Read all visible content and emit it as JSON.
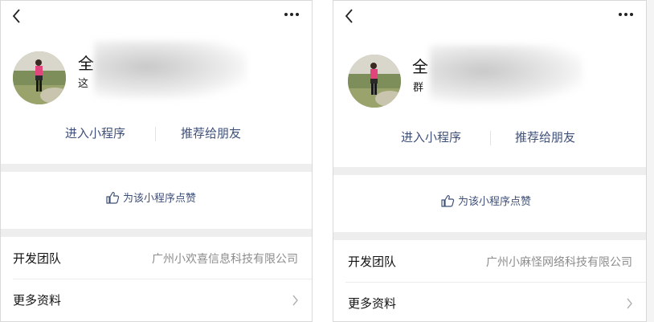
{
  "panels": [
    {
      "name_char": "全",
      "desc_char": "这",
      "actions": {
        "enter": "进入小程序",
        "recommend": "推荐给朋友"
      },
      "like_label": "为该小程序点赞",
      "team_label": "开发团队",
      "team_value": "广州小欢喜信息科技有限公司",
      "more_label": "更多资料"
    },
    {
      "name_char": "全",
      "desc_char": "群",
      "actions": {
        "enter": "进入小程序",
        "recommend": "推荐给朋友"
      },
      "like_label": "为该小程序点赞",
      "team_label": "开发团队",
      "team_value": "广州小麻怪网络科技有限公司",
      "more_label": "更多资料"
    }
  ],
  "colors": {
    "link": "#3f5078",
    "value_gray": "#8c8c8c",
    "band": "#eeeeee",
    "avatar_accent": "#e0457b"
  },
  "icons": [
    "back-icon",
    "more-icon",
    "thumbs-up-icon",
    "chevron-right-icon",
    "avatar-image",
    "blurred-region"
  ]
}
